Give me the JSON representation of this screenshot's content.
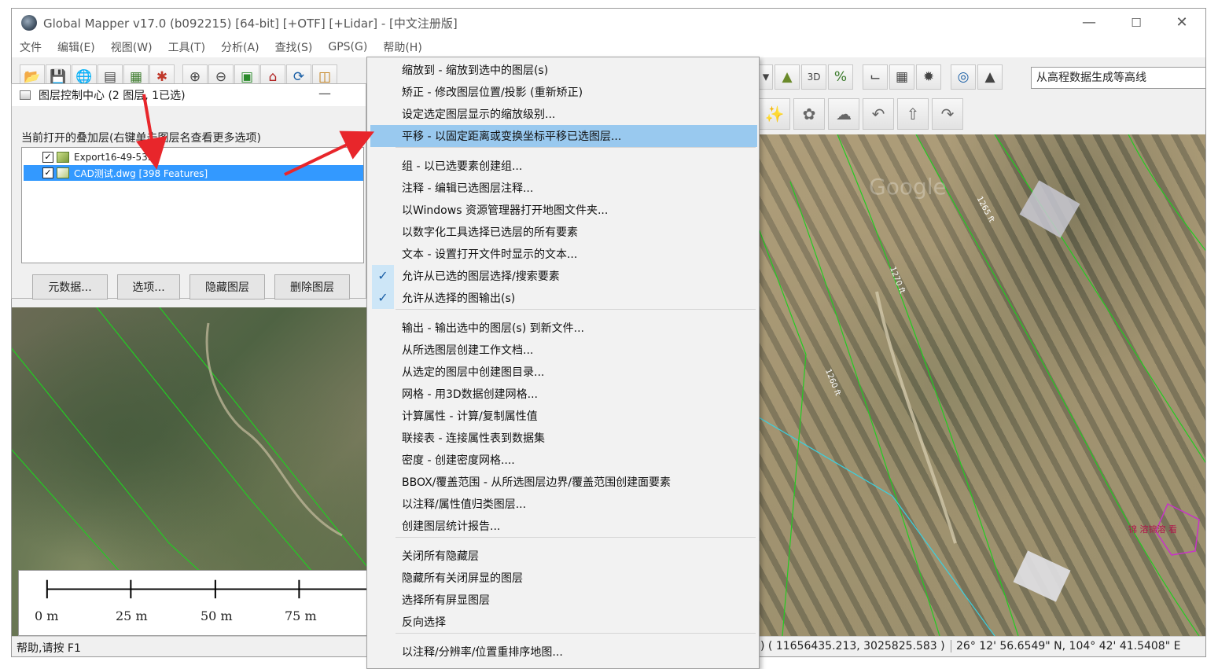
{
  "window": {
    "title": "Global Mapper v17.0 (b092215) [64-bit] [+OTF] [+Lidar] - [中文注册版]",
    "controls": {
      "minimize": "—",
      "maximize": "☐",
      "close": "✕"
    }
  },
  "menubar": [
    "文件",
    "编辑(E)",
    "视图(W)",
    "工具(T)",
    "分析(A)",
    "查找(S)",
    "GPS(G)",
    "帮助(H)"
  ],
  "toolbar": {
    "left_icons": [
      "open-folder-icon",
      "save-icon",
      "globe-icon",
      "layer-control-icon",
      "overlay-icon",
      "digitizer-icon",
      "zoom-in-icon",
      "zoom-out-icon",
      "zoom-to-layer-icon",
      "home-icon",
      "refresh-icon",
      "grid-icon"
    ],
    "combo_value": "从高程数据生成等高线"
  },
  "layer_panel": {
    "title": "图层控制中心 (2 图层, 1已选)",
    "list_label": "当前打开的叠加层(右键单击图层名查看更多选项)",
    "layers": [
      {
        "name": "Export16-49-53.tif",
        "checked": "✓",
        "selected": false
      },
      {
        "name": "CAD测试.dwg [398 Features]",
        "checked": "✓",
        "selected": true
      }
    ],
    "buttons": {
      "metadata": "元数据...",
      "options": "选项...",
      "hide": "隐藏图层",
      "delete": "删除图层"
    }
  },
  "scalebar": {
    "labels": [
      "0 m",
      "25 m",
      "50 m",
      "75 m"
    ]
  },
  "context_menu": {
    "items": [
      {
        "label": "缩放到 - 缩放到选中的图层(s)",
        "checked": false
      },
      {
        "label": "矫正 - 修改图层位置/投影 (重新矫正)",
        "checked": false
      },
      {
        "label": "设定选定图层显示的缩放级别...",
        "checked": false
      },
      {
        "label": "平移 - 以固定距离或变换坐标平移已选图层...",
        "checked": false,
        "highlight": true
      },
      {
        "label": "组 - 以已选要素创建组...",
        "checked": false
      },
      {
        "label": "注释 - 编辑已选图层注释...",
        "checked": false
      },
      {
        "label": "以Windows 资源管理器打开地图文件夹...",
        "checked": false
      },
      {
        "label": "以数字化工具选择已选层的所有要素",
        "checked": false
      },
      {
        "label": "文本 - 设置打开文件时显示的文本...",
        "checked": false
      },
      {
        "label": "允许从已选的图层选择/搜索要素",
        "checked": true
      },
      {
        "label": "允许从选择的图输出(s)",
        "checked": true
      },
      {
        "label": "输出 - 输出选中的图层(s) 到新文件...",
        "checked": false
      },
      {
        "label": "从所选图层创建工作文档...",
        "checked": false
      },
      {
        "label": "从选定的图层中创建图目录...",
        "checked": false
      },
      {
        "label": "网格 - 用3D数据创建网格...",
        "checked": false
      },
      {
        "label": "计算属性 - 计算/复制属性值",
        "checked": false
      },
      {
        "label": "联接表 - 连接属性表到数据集",
        "checked": false
      },
      {
        "label": "密度 - 创建密度网格....",
        "checked": false
      },
      {
        "label": "BBOX/覆盖范围  - 从所选图层边界/覆盖范围创建面要素",
        "checked": false
      },
      {
        "label": "以注释/属性值归类图层...",
        "checked": false
      },
      {
        "label": "创建图层统计报告...",
        "checked": false
      },
      {
        "label": "关闭所有隐藏层",
        "checked": false
      },
      {
        "label": "隐藏所有关闭屏显的图层",
        "checked": false
      },
      {
        "label": "选择所有屏显图层",
        "checked": false
      },
      {
        "label": "反向选择",
        "checked": false
      },
      {
        "label": "以注释/分辨率/位置重排序地图...",
        "checked": false
      }
    ],
    "check_glyph": "✓"
  },
  "map": {
    "contour_labels": [
      "1265 ft",
      "1270 ft",
      "1260 ft"
    ],
    "watermark": "Google",
    "feature_label": "锦 溶锦溶 看"
  },
  "statusbar": {
    "help": "帮助,请按 F1",
    "coords": ") ( 11656435.213, 3025825.583 )",
    "latlon": "26° 12' 56.6549\" N, 104° 42' 41.5408\" E"
  },
  "colors": {
    "menu_highlight": "#99c9ef",
    "selection": "#3399ff",
    "contour_line": "#22cc22",
    "annotation_arrow": "#e8262b"
  }
}
